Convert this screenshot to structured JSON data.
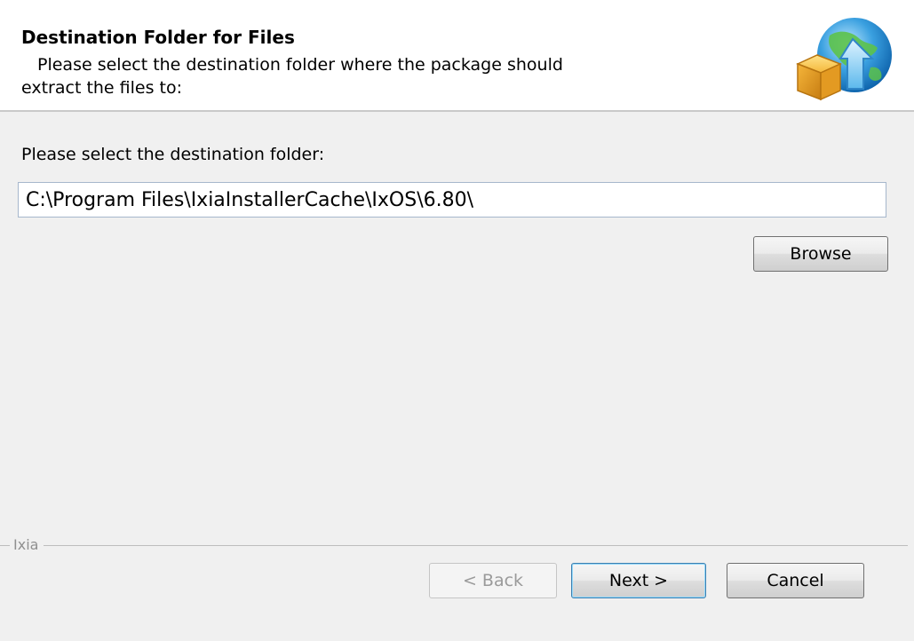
{
  "header": {
    "title": "Destination Folder for Files",
    "subtitle_line1": "Please select the destination folder where the package should",
    "subtitle_line2": "extract the files to:",
    "logo_icon": "installer-globe-box-icon"
  },
  "main": {
    "prompt": "Please select the destination folder:",
    "path_value": "C:\\Program Files\\IxiaInstallerCache\\IxOS\\6.80\\",
    "browse_label": "Browse"
  },
  "footer": {
    "group_label": "Ixia",
    "back_label": "< Back",
    "next_label": "Next >",
    "cancel_label": "Cancel"
  }
}
